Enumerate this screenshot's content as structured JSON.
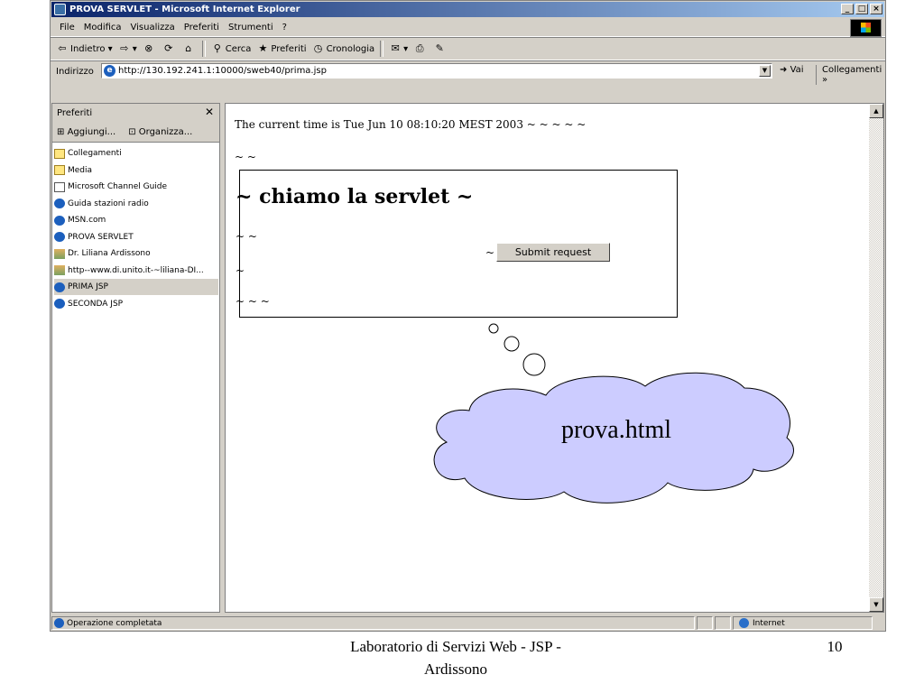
{
  "window": {
    "title": "PROVA SERVLET - Microsoft Internet Explorer",
    "btn_min": "_",
    "btn_max": "□",
    "btn_close": "×"
  },
  "menu": [
    "File",
    "Modifica",
    "Visualizza",
    "Preferiti",
    "Strumenti",
    "?"
  ],
  "toolbar": {
    "back": "Indietro",
    "search": "Cerca",
    "favorites": "Preferiti",
    "history": "Cronologia"
  },
  "address": {
    "label": "Indirizzo",
    "url": "http://130.192.241.1:10000/sweb40/prima.jsp",
    "go": "Vai",
    "links": "Collegamenti"
  },
  "sidebar": {
    "title": "Preferiti",
    "add": "Aggiungi...",
    "organize": "Organizza...",
    "items": [
      {
        "label": "Collegamenti",
        "icon": "folder-icon"
      },
      {
        "label": "Media",
        "icon": "folder-icon"
      },
      {
        "label": "Microsoft Channel Guide",
        "icon": "doc-icon"
      },
      {
        "label": "Guida stazioni radio",
        "icon": "ie-icon"
      },
      {
        "label": "MSN.com",
        "icon": "ie-icon"
      },
      {
        "label": "PROVA SERVLET",
        "icon": "ie-icon"
      },
      {
        "label": "Dr. Liliana Ardissono",
        "icon": "image-icon"
      },
      {
        "label": "http--www.di.unito.it-~liliana-DI...",
        "icon": "image-icon"
      },
      {
        "label": "PRIMA JSP",
        "icon": "ie-icon"
      },
      {
        "label": "SECONDA JSP",
        "icon": "ie-icon"
      }
    ],
    "selected_index": 8
  },
  "page": {
    "time_text": "The current time is Tue Jun 10 08:10:20 MEST 2003 ~ ~ ~ ~ ~",
    "tilde2": "~ ~",
    "heading": "~ chiamo la servlet ~",
    "row1": "~ ~",
    "submit_prefix": "~",
    "submit_label": "Submit request",
    "row2": "~",
    "row3": "~ ~ ~"
  },
  "cloud": {
    "text": "prova.html",
    "fill": "#ccccff"
  },
  "status": {
    "text": "Operazione completata",
    "zone": "Internet"
  },
  "footer": {
    "line1": "Laboratorio di Servizi Web - JSP -",
    "line2": "Ardissono",
    "page_number": "10"
  }
}
